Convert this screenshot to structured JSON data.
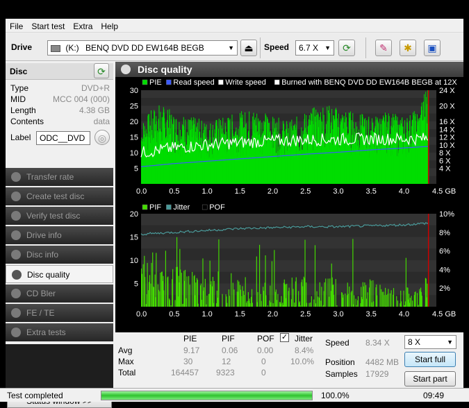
{
  "menu": [
    "File",
    "Start test",
    "Extra",
    "Help"
  ],
  "toolbar": {
    "drive_label": "Drive",
    "drive_letter": "(K:)",
    "drive_name": "BENQ DVD DD EW164B BEGB",
    "speed_label": "Speed",
    "speed_value": "6.7 X"
  },
  "disc": {
    "header": "Disc",
    "info": [
      {
        "key": "Type",
        "value": "DVD+R"
      },
      {
        "key": "MID",
        "value": "MCC 004 (000)"
      },
      {
        "key": "Length",
        "value": "4.38 GB"
      },
      {
        "key": "Contents",
        "value": "data"
      }
    ],
    "label_key": "Label",
    "label_value": "ODC__DVD"
  },
  "nav": [
    {
      "label": "Transfer rate",
      "active": false
    },
    {
      "label": "Create test disc",
      "active": false
    },
    {
      "label": "Verify test disc",
      "active": false
    },
    {
      "label": "Drive info",
      "active": false
    },
    {
      "label": "Disc info",
      "active": false
    },
    {
      "label": "Disc quality",
      "active": true
    },
    {
      "label": "CD Bler",
      "active": false
    },
    {
      "label": "FE / TE",
      "active": false
    },
    {
      "label": "Extra tests",
      "active": false
    }
  ],
  "status_window_btn": "Status window >>",
  "main_title": "Disc quality",
  "colors": {
    "pie": "#00dd00",
    "read": "#3b5bff",
    "write": "#ffffff",
    "pif": "#44dd00",
    "jitter": "#4a9a9a",
    "pof": "#000000",
    "marker": "#cc0000"
  },
  "chart_data": [
    {
      "type": "area",
      "legend": [
        {
          "name": "PIE",
          "color": "#00dd00"
        },
        {
          "name": "Read speed",
          "color": "#3b5bff"
        },
        {
          "name": "Write speed",
          "color": "#ffffff"
        },
        {
          "name": "Burned with BENQ DVD DD EW164B BEGB at 12X",
          "color": "#ffffff"
        }
      ],
      "x_ticks": [
        "0.0",
        "0.5",
        "1.0",
        "1.5",
        "2.0",
        "2.5",
        "3.0",
        "3.5",
        "4.0",
        "4.5 GB"
      ],
      "y_left_ticks": [
        "5",
        "10",
        "15",
        "20",
        "25",
        "30"
      ],
      "y_right_ticks": [
        "4 X",
        "6 X",
        "8 X",
        "10 X",
        "12 X",
        "14 X",
        "16 X",
        "20 X",
        "24 X"
      ],
      "xlim": [
        0,
        4.5
      ],
      "ylim": [
        0,
        30
      ],
      "end_marker": 4.38,
      "series": [
        {
          "name": "PIE",
          "note": "baseline ~10-15, spikes to ~30",
          "x": [
            0.0,
            0.25,
            0.5,
            0.75,
            1.0,
            1.25,
            1.5,
            1.75,
            2.0,
            2.25,
            2.5,
            2.75,
            3.0,
            3.25,
            3.5,
            3.75,
            4.0,
            4.25,
            4.38
          ],
          "values": [
            14,
            18,
            16,
            15,
            14,
            15,
            16,
            17,
            15,
            14,
            16,
            18,
            17,
            16,
            15,
            16,
            15,
            17,
            26
          ]
        },
        {
          "name": "Read speed",
          "x": [
            0.0,
            0.5,
            1.0,
            1.5,
            2.0,
            2.5,
            3.0,
            3.5,
            4.0,
            4.38
          ],
          "values": [
            4.4,
            5.2,
            5.8,
            6.4,
            7.0,
            7.6,
            8.1,
            8.7,
            9.2,
            9.6
          ]
        },
        {
          "name": "Write speed",
          "x": [
            0.0,
            0.5,
            1.0,
            1.5,
            2.0,
            2.5,
            3.0,
            3.5,
            4.0,
            4.38
          ],
          "values": [
            8.0,
            9.2,
            10.0,
            10.6,
            11.0,
            11.3,
            11.4,
            11.5,
            11.5,
            11.6
          ]
        }
      ]
    },
    {
      "type": "bar",
      "legend": [
        {
          "name": "PIF",
          "color": "#44dd00"
        },
        {
          "name": "Jitter",
          "color": "#4a9a9a"
        },
        {
          "name": "POF",
          "color": "#000000"
        }
      ],
      "x_ticks": [
        "0.0",
        "0.5",
        "1.0",
        "1.5",
        "2.0",
        "2.5",
        "3.0",
        "3.5",
        "4.0",
        "4.5 GB"
      ],
      "y_left_ticks": [
        "5",
        "10",
        "15",
        "20"
      ],
      "y_right_ticks": [
        "2%",
        "4%",
        "6%",
        "8%",
        "10%"
      ],
      "xlim": [
        0,
        4.5
      ],
      "ylim": [
        0,
        20
      ],
      "end_marker": 4.38,
      "series": [
        {
          "name": "PIF",
          "x": [
            0.0,
            0.25,
            0.5,
            0.75,
            1.0,
            1.25,
            1.5,
            1.75,
            2.0,
            2.25,
            2.5,
            2.75,
            3.0,
            3.25,
            3.5,
            3.75,
            4.0,
            4.25,
            4.38
          ],
          "values": [
            4,
            6,
            5,
            4,
            3,
            4,
            3,
            3,
            2,
            3,
            3,
            3,
            3,
            2,
            3,
            2,
            2,
            2,
            4
          ]
        },
        {
          "name": "Jitter",
          "x": [
            0.0,
            0.5,
            1.0,
            1.5,
            2.0,
            2.5,
            3.0,
            3.5,
            4.0,
            4.38
          ],
          "values": [
            7.8,
            8.0,
            8.2,
            8.4,
            8.5,
            8.6,
            8.6,
            8.7,
            8.8,
            9.0
          ]
        }
      ]
    }
  ],
  "stats": {
    "headers": [
      "PIE",
      "PIF",
      "POF",
      "Jitter"
    ],
    "rows": [
      {
        "label": "Avg",
        "pie": "9.17",
        "pif": "0.06",
        "pof": "0.00",
        "jitter": "8.4%"
      },
      {
        "label": "Max",
        "pie": "30",
        "pif": "12",
        "pof": "0",
        "jitter": "10.0%"
      },
      {
        "label": "Total",
        "pie": "164457",
        "pif": "9323",
        "pof": "0",
        "jitter": ""
      }
    ],
    "jitter_checked": true,
    "speed_label": "Speed",
    "speed_value": "8.34 X",
    "speed_select": "8 X",
    "position_label": "Position",
    "position_value": "4482 MB",
    "samples_label": "Samples",
    "samples_value": "17929",
    "start_full": "Start full",
    "start_part": "Start part"
  },
  "status": {
    "text": "Test completed",
    "progress": 100,
    "progress_text": "100.0%",
    "time": "09:49"
  }
}
